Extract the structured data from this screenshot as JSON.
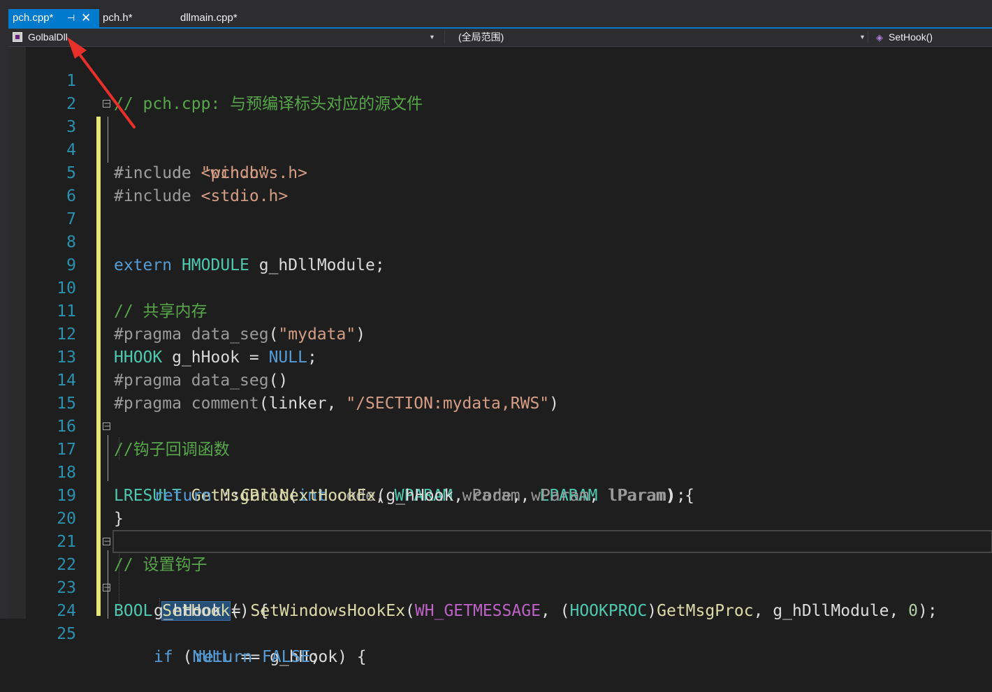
{
  "tabs": [
    {
      "label": "pch.cpp*",
      "active": true,
      "pin_icon": "pin-icon",
      "close_icon": "close-icon"
    },
    {
      "label": "pch.h*"
    },
    {
      "label": "dllmain.cpp*"
    }
  ],
  "nav": {
    "project": "GolbalDll",
    "scope": "(全局范围)",
    "member": "SetHook()"
  },
  "colors": {
    "accent": "#007acc",
    "background": "#1e1e1e",
    "line_number": "#2b91af",
    "comment": "#57a64a",
    "keyword": "#569cd6",
    "type": "#4ec9b0",
    "string": "#d69d85",
    "function": "#dcdcaa",
    "change_bar": "#e6e67a",
    "annotation_arrow": "#e8302a"
  },
  "code": {
    "line_numbers": [
      "1",
      "2",
      "3",
      "4",
      "5",
      "6",
      "7",
      "8",
      "9",
      "10",
      "11",
      "12",
      "13",
      "14",
      "15",
      "16",
      "17",
      "18",
      "19",
      "20",
      "21",
      "22",
      "23",
      "24",
      "25"
    ],
    "l1": "// pch.cpp: 与预编译标头对应的源文件",
    "l3_pp": "#include ",
    "l3_str": "\"pch.h\"",
    "l4_pp": "#include ",
    "l4_str": "<windows.h>",
    "l5_pp": "#include ",
    "l5_str": "<stdio.h>",
    "l8_kw": "extern",
    "l8_type": "HMODULE",
    "l8_rest": " g_hDllModule;",
    "l10": "// 共享内存",
    "l11_pp": "#pragma data_seg",
    "l11_p1": "(",
    "l11_str": "\"mydata\"",
    "l11_p2": ")",
    "l12_type": "HHOOK",
    "l12_var": " g_hHook = ",
    "l12_macro": "NULL",
    "l12_end": ";",
    "l13_pp": "#pragma data_seg",
    "l13_rest": "()",
    "l14_pp": "#pragma comment",
    "l14_p1": "(linker, ",
    "l14_str": "\"/SECTION:mydata,RWS\"",
    "l14_p2": ")",
    "l16": "//钩子回调函数",
    "l17_type": "LRESULT",
    "l17_fn": " GetMsgProc",
    "l17_p1": "(",
    "l17_kw": "int",
    "l17_a1": " code",
    "l17_c1": ", ",
    "l17_t2": "WPARAM",
    "l17_a2": " wParam",
    "l17_c2": ", ",
    "l17_t3": "LPARAM",
    "l17_a3": " lParam",
    "l17_end": ") {",
    "l18_kw": "return",
    "l18_s": " ::",
    "l18_fn": "CallNextHookEx",
    "l18_p1": "(g_hHook, ",
    "l18_a1": "code",
    "l18_c1": ", ",
    "l18_a2": "wParam",
    "l18_c2": ", ",
    "l18_a3": "lParam",
    "l18_end": ");",
    "l19": "}",
    "l21": "// 设置钩子",
    "l22_type": "BOOL",
    "l22_sp": " ",
    "l22_fn": "SetHook",
    "l22_end": "() {",
    "l23_var": "g_hHook = ",
    "l23_fn": "SetWindowsHookEx",
    "l23_p1": "(",
    "l23_macro": "WH_GETMESSAGE",
    "l23_c1": ", (",
    "l23_type": "HOOKPROC",
    "l23_p2": ")",
    "l23_fn2": "GetMsgProc",
    "l23_c2": ", g_hDllModule, ",
    "l23_num": "0",
    "l23_end": ");",
    "l24_kw": "if",
    "l24_p1": " (",
    "l24_macro": "NULL",
    "l24_rest": " == g_hHook) {",
    "l25_kw": "return",
    "l25_sp": " ",
    "l25_macro": "FALSE",
    "l25_end": ";"
  }
}
